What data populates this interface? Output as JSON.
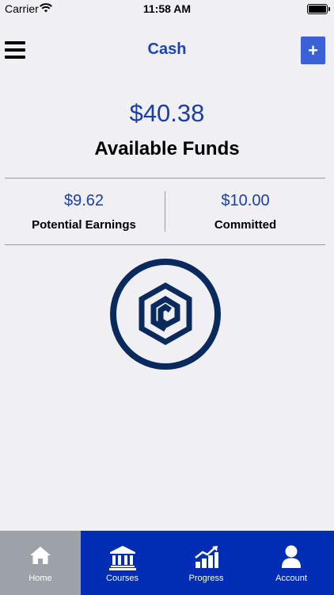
{
  "status_bar": {
    "carrier": "Carrier",
    "time": "11:58 AM"
  },
  "header": {
    "title": "Cash",
    "add_label": "+"
  },
  "balance": {
    "amount": "$40.38",
    "label": "Available Funds"
  },
  "stats": [
    {
      "value": "$9.62",
      "label": "Potential Earnings"
    },
    {
      "value": "$10.00",
      "label": "Committed"
    }
  ],
  "tabs": [
    {
      "label": "Home",
      "icon": "home-icon",
      "active": true
    },
    {
      "label": "Courses",
      "icon": "bank-icon",
      "active": false
    },
    {
      "label": "Progress",
      "icon": "chart-icon",
      "active": false
    },
    {
      "label": "Account",
      "icon": "user-icon",
      "active": false
    }
  ],
  "colors": {
    "accent": "#1b45b3",
    "tab_bar": "#002db3",
    "tab_active": "#9da1a8",
    "logo": "#0a2a5e",
    "add_button": "#3a62d6"
  }
}
